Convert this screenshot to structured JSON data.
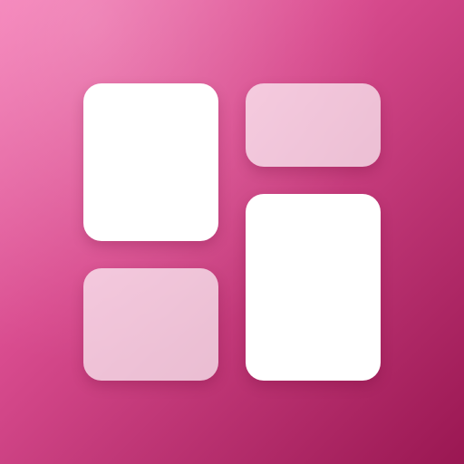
{
  "icon": {
    "semantic_name": "dashboard-grid-icon",
    "colors": {
      "background_start": "#f47bb5",
      "background_mid": "#d94c8f",
      "background_end": "#9a1752",
      "tile_solid": "#ffffff",
      "tile_faded": "#f2d6e3"
    },
    "tiles": [
      {
        "name": "top-left",
        "style": "solid"
      },
      {
        "name": "top-right",
        "style": "faded"
      },
      {
        "name": "bottom-left",
        "style": "faded"
      },
      {
        "name": "bottom-right",
        "style": "solid"
      }
    ]
  }
}
